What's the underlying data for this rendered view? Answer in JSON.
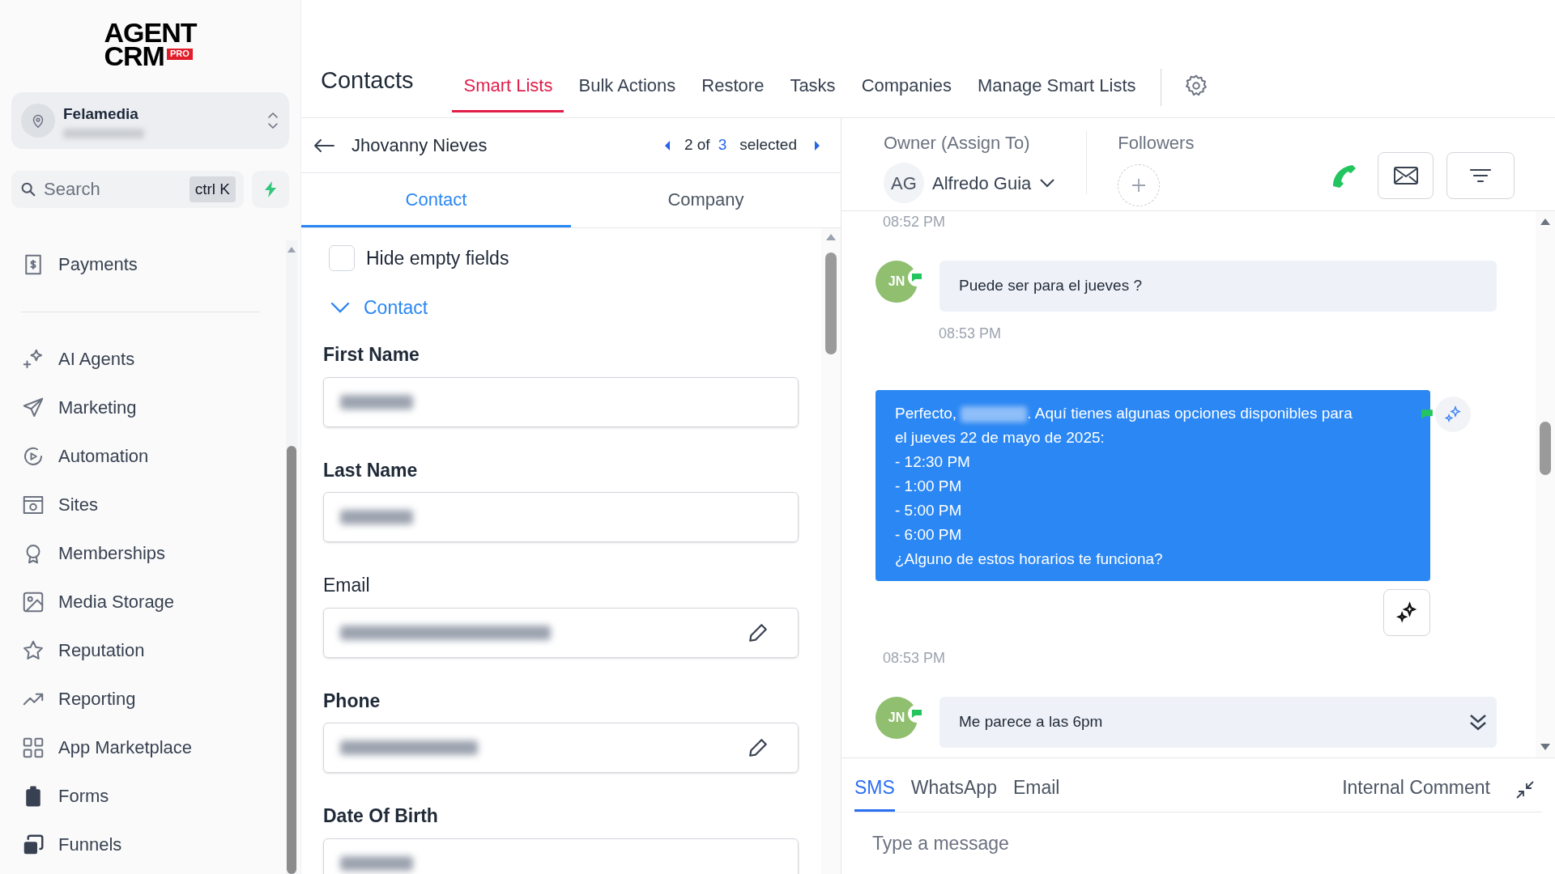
{
  "logo": {
    "line1": "AGENT",
    "line2": "CRM",
    "badge": "PRO"
  },
  "account": {
    "name": "Felamedia"
  },
  "search": {
    "placeholder": "Search",
    "shortcut": "ctrl K"
  },
  "sidebar": {
    "groups": [
      {
        "items": [
          {
            "label": "Payments"
          }
        ]
      },
      {
        "items": [
          {
            "label": "AI Agents"
          },
          {
            "label": "Marketing"
          },
          {
            "label": "Automation"
          },
          {
            "label": "Sites"
          },
          {
            "label": "Memberships"
          },
          {
            "label": "Media Storage"
          },
          {
            "label": "Reputation"
          },
          {
            "label": "Reporting"
          },
          {
            "label": "App Marketplace"
          },
          {
            "label": "Forms"
          },
          {
            "label": "Funnels"
          }
        ]
      }
    ]
  },
  "header": {
    "title": "Contacts",
    "tabs": [
      {
        "label": "Smart Lists",
        "selected": true
      },
      {
        "label": "Bulk Actions",
        "selected": false
      },
      {
        "label": "Restore",
        "selected": false
      },
      {
        "label": "Tasks",
        "selected": false
      },
      {
        "label": "Companies",
        "selected": false
      },
      {
        "label": "Manage Smart Lists",
        "selected": false
      }
    ]
  },
  "record": {
    "name": "Jhovanny Nieves",
    "position": "2 of",
    "count": "3",
    "count_label": "selected"
  },
  "record_tabs": [
    {
      "label": "Contact",
      "selected": true
    },
    {
      "label": "Company",
      "selected": false
    }
  ],
  "hide_empty": {
    "label": "Hide empty fields",
    "checked": false
  },
  "section": {
    "title": "Contact",
    "expanded": true
  },
  "fields": [
    {
      "label": "First Name",
      "editable": false
    },
    {
      "label": "Last Name",
      "editable": false
    },
    {
      "label": "Email",
      "editable": true
    },
    {
      "label": "Phone",
      "editable": true
    },
    {
      "label": "Date Of Birth",
      "editable": false
    }
  ],
  "owner": {
    "label": "Owner (Assign To)",
    "initials": "AG",
    "name": "Alfredo Guia"
  },
  "followers": {
    "label": "Followers"
  },
  "messages": [
    {
      "kind": "time",
      "text": "08:52 PM"
    },
    {
      "kind": "inbound",
      "initials": "JN",
      "text": "Puede ser para el jueves ?"
    },
    {
      "kind": "time_indented",
      "text": "08:53 PM"
    },
    {
      "kind": "outbound",
      "text_before": "Perfecto, ",
      "text_after": ". Aquí tienes algunas opciones disponibles para\nel jueves 22 de mayo de 2025:\n- 12:30 PM\n- 1:00 PM\n- 5:00 PM\n- 6:00 PM\n¿Alguno de estos horarios te funciona?"
    },
    {
      "kind": "time",
      "text": "08:53 PM"
    },
    {
      "kind": "inbound",
      "initials": "JN",
      "text": "Me parece a las 6pm"
    }
  ],
  "composer": {
    "tabs": [
      {
        "label": "SMS",
        "selected": true
      },
      {
        "label": "WhatsApp",
        "selected": false
      },
      {
        "label": "Email",
        "selected": false
      }
    ],
    "internal": "Internal Comment",
    "placeholder": "Type a message"
  }
}
